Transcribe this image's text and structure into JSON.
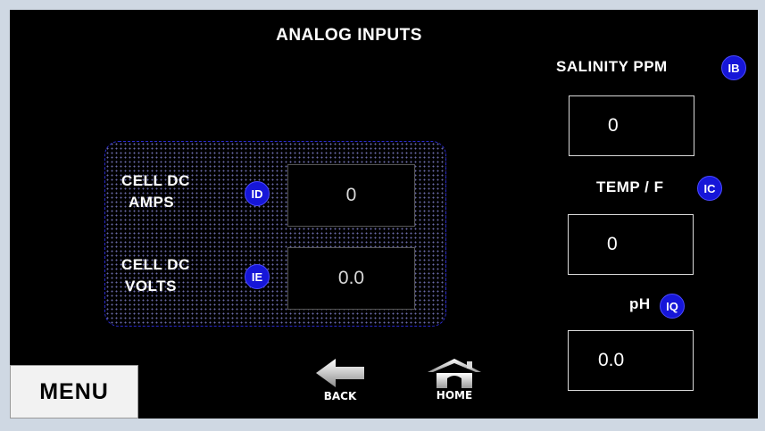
{
  "screen": {
    "title": "ANALOG INPUTS"
  },
  "salinity": {
    "label": "SALINITY PPM",
    "badge": "IB",
    "value": "0"
  },
  "temp": {
    "label": "TEMP / F",
    "badge": "IC",
    "value": "0"
  },
  "ph": {
    "label": "pH",
    "badge": "IQ",
    "value": "0.0"
  },
  "cell_amps": {
    "label_line1": "CELL DC",
    "label_line2": "AMPS",
    "badge": "ID",
    "value": "0"
  },
  "cell_volts": {
    "label_line1": "CELL DC",
    "label_line2": "VOLTS",
    "badge": "IE",
    "value": "0.0"
  },
  "nav": {
    "menu_label": "MENU",
    "back_label": "BACK",
    "home_label": "HOME"
  },
  "icons": {
    "back": "left-arrow-icon",
    "home": "house-icon"
  },
  "colors": {
    "background": "#000000",
    "badge": "#1616d8",
    "panel_border": "#2a2ad0",
    "text": "#ffffff"
  }
}
